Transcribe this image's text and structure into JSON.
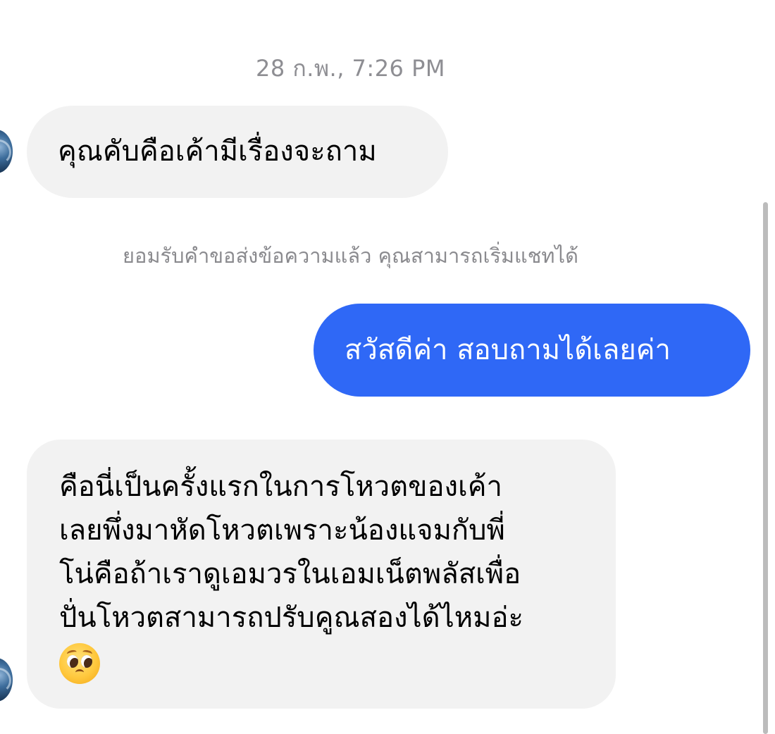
{
  "chat": {
    "timestamp": "28 ก.พ., 7:26 PM",
    "system_note": "ยอมรับคำขอส่งข้อความแล้ว คุณสามารถเริ่มแชทได้",
    "messages": [
      {
        "direction": "incoming",
        "text": "คุณคับคือเค้ามีเรื่องจะถาม"
      },
      {
        "direction": "outgoing",
        "text": "สวัสดีค่า สอบถามได้เลยค่า"
      },
      {
        "direction": "incoming",
        "lines": [
          "คือนี่เป็นครั้งแรกในการโหวตของเค้า",
          "เลยพึ่งมาหัดโหวตเพราะน้องแจมกับพี่",
          "โน่คือถ้าเราดูเอมวรในเอมเน็ตพลัสเพื่อ",
          "ปั่นโหวตสามารถปรับคูณสองได้ไหมอ่ะ"
        ],
        "emoji": "pleading-face-emoji"
      }
    ]
  },
  "colors": {
    "incoming_bubble": "#f2f2f2",
    "outgoing_bubble": "#2f68f6",
    "timestamp_text": "#8e8e93",
    "system_text": "#8a8a8e"
  },
  "icons": {
    "avatar": "sender-avatar",
    "emoji": "pleading-face-emoji"
  }
}
